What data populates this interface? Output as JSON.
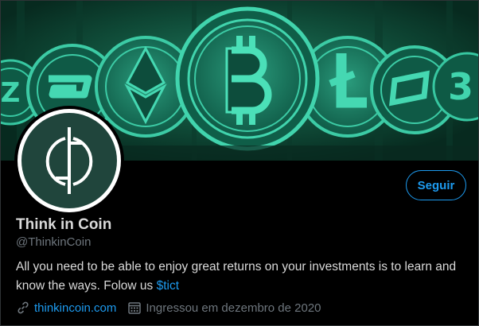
{
  "profile": {
    "name": "Think in Coin",
    "handle": "@ThinkinCoin",
    "bio_text": "All you need to be able to enjoy great returns on your investments is to learn and know the ways. Folow us ",
    "bio_cashtag": "$tict",
    "website": "thinkincoin.com",
    "joined": "Ingressou em dezembro de 2020"
  },
  "actions": {
    "follow_label": "Seguir"
  },
  "colors": {
    "accent": "#1d9bf0",
    "background": "#000000",
    "banner": "#0c3a2b",
    "avatar_bg": "#20453c"
  },
  "icons": {
    "website": "link-icon",
    "joined": "calendar-icon",
    "banner_coins": [
      "zcash-icon",
      "dash-icon",
      "ethereum-icon",
      "bitcoin-icon",
      "litecoin-icon",
      "number-3-icon"
    ]
  }
}
